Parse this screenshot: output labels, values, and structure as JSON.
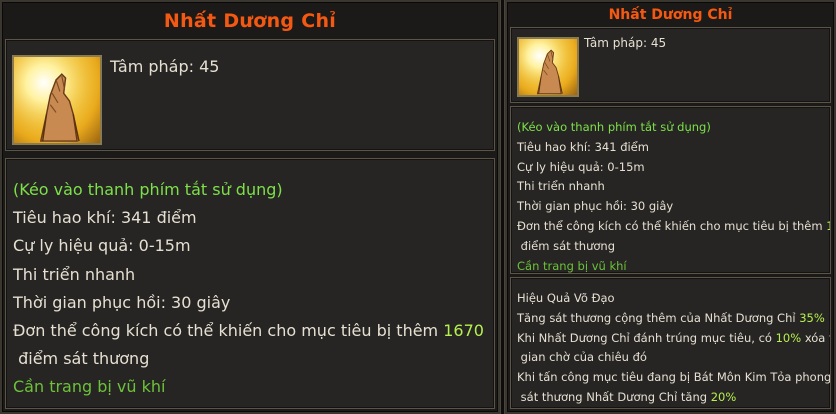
{
  "skill": {
    "name": "Nhất Dương Chỉ",
    "tam_phap": "Tâm pháp: 45",
    "icon": "praying-hand-icon",
    "hint": "(Kéo vào thanh phím tắt sử dụng)",
    "cost": "Tiêu hao khí: 341 điểm",
    "range": "Cự ly hiệu quả: 0-15m",
    "cast": "Thi triển nhanh",
    "cooldown": "Thời gian phục hồi: 30 giây",
    "effect_prefix": "Đơn thể công kích có thể khiến cho mục tiêu bị thêm",
    "effect_value": "1670",
    "effect_suffix": "điểm sát thương",
    "requirement": "Cần trang bị vũ khí"
  },
  "vo_dao": {
    "heading": "Hiệu Quả Võ Đạo",
    "line1_prefix": "Tăng sát thương cộng thêm của Nhất Dương Chỉ",
    "line1_value": "35%",
    "line2_prefix": "Khi Nhất Dương Chỉ đánh trúng mục tiêu, có",
    "line2_value": "10%",
    "line2_suffix": "xóa thời",
    "line2_cont": "gian chờ của chiêu đó",
    "line3": "Khi tấn công mục tiêu đang bị Bát Môn Kim Tỏa phong ấn,",
    "line3_cont_prefix": "sát thương Nhất Dương Chỉ tăng",
    "line3_value": "20%"
  },
  "colors": {
    "title": "#f05a14",
    "text": "#e6e0d2",
    "green": "#7de04a",
    "highlight": "#b6f04e"
  }
}
